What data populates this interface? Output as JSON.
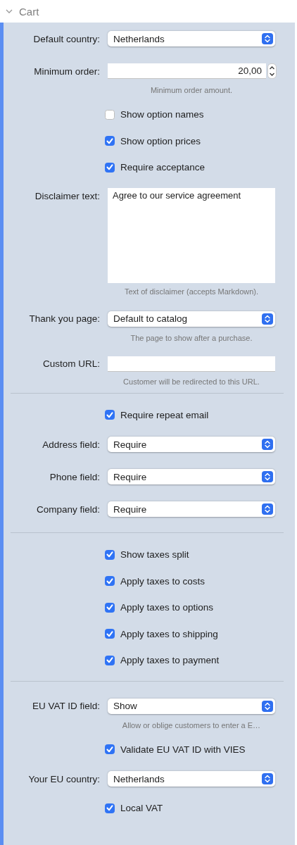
{
  "section": {
    "title": "Cart",
    "expanded": true
  },
  "rows": [
    {
      "kind": "select",
      "label": "Default country:",
      "value": "Netherlands"
    },
    {
      "kind": "stepper",
      "label": "Minimum order:",
      "value": "20,00",
      "hint": "Minimum order amount."
    },
    {
      "kind": "checkbox",
      "label": "Show option names",
      "checked": false
    },
    {
      "kind": "checkbox",
      "label": "Show option prices",
      "checked": true
    },
    {
      "kind": "checkbox",
      "label": "Require acceptance",
      "checked": true
    },
    {
      "kind": "textarea",
      "label": "Disclaimer text:",
      "value": "Agree to our service agreement",
      "hint": "Text of disclaimer (accepts Markdown)."
    },
    {
      "kind": "select",
      "label": "Thank you page:",
      "value": "Default to catalog",
      "hint": "The page to show after a purchase."
    },
    {
      "kind": "text",
      "label": "Custom URL:",
      "hint": "Customer will be redirected to this URL."
    },
    {
      "kind": "divider"
    },
    {
      "kind": "checkbox",
      "label": "Require repeat email",
      "checked": true
    },
    {
      "kind": "select",
      "label": "Address field:",
      "value": "Require"
    },
    {
      "kind": "select",
      "label": "Phone field:",
      "value": "Require"
    },
    {
      "kind": "select",
      "label": "Company field:",
      "value": "Require"
    },
    {
      "kind": "divider"
    },
    {
      "kind": "checkbox",
      "label": "Show taxes split",
      "checked": true
    },
    {
      "kind": "checkbox",
      "label": "Apply taxes to costs",
      "checked": true
    },
    {
      "kind": "checkbox",
      "label": "Apply taxes to options",
      "checked": true
    },
    {
      "kind": "checkbox",
      "label": "Apply taxes to shipping",
      "checked": true
    },
    {
      "kind": "checkbox",
      "label": "Apply taxes to payment",
      "checked": true
    },
    {
      "kind": "divider"
    },
    {
      "kind": "select",
      "label": "EU VAT ID field:",
      "value": "Show",
      "hint": "Allow or oblige customers to enter a E…"
    },
    {
      "kind": "checkbox",
      "label": "Validate EU VAT ID with VIES",
      "checked": true
    },
    {
      "kind": "select",
      "label": "Your EU country:",
      "value": "Netherlands"
    },
    {
      "kind": "checkbox",
      "label": "Local VAT",
      "checked": true
    }
  ]
}
